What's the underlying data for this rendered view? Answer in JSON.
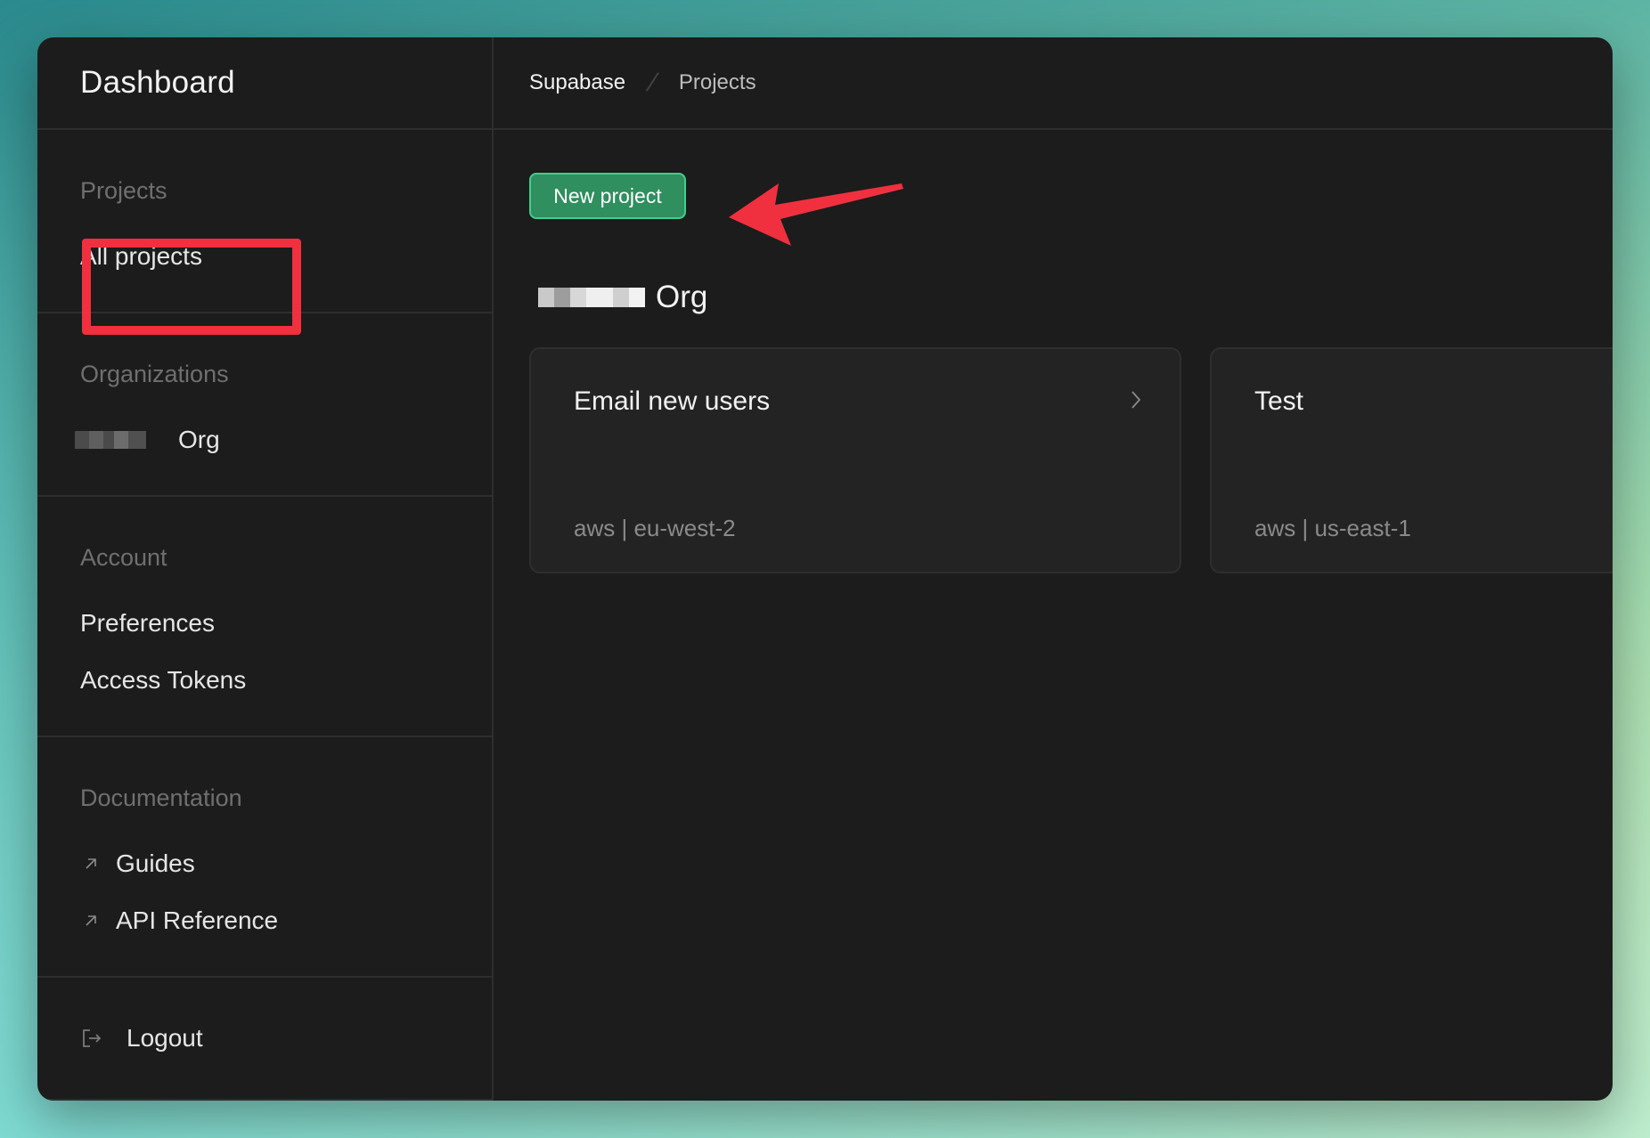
{
  "colors": {
    "accent_green": "#3fcf8e",
    "button_fill": "#2f8f5e",
    "annotation_red": "#f0303f",
    "panel_bg": "#1c1c1c"
  },
  "sidebar": {
    "title": "Dashboard",
    "sections": {
      "projects": {
        "title": "Projects",
        "items": [
          {
            "label": "All projects"
          }
        ]
      },
      "organizations": {
        "title": "Organizations",
        "items": [
          {
            "label": "Org"
          }
        ]
      },
      "account": {
        "title": "Account",
        "items": [
          {
            "label": "Preferences"
          },
          {
            "label": "Access Tokens"
          }
        ]
      },
      "documentation": {
        "title": "Documentation",
        "items": [
          {
            "label": "Guides",
            "icon": "external-link-icon"
          },
          {
            "label": "API Reference",
            "icon": "external-link-icon"
          }
        ]
      }
    },
    "logout": {
      "label": "Logout",
      "icon": "logout-icon"
    }
  },
  "breadcrumb": {
    "root": "Supabase",
    "separator": "/",
    "current": "Projects"
  },
  "main": {
    "new_project_label": "New project",
    "org_heading": "Org",
    "projects": [
      {
        "name": "Email new users",
        "provider": "aws | eu-west-2"
      },
      {
        "name": "Test",
        "provider": "aws | us-east-1"
      }
    ]
  }
}
